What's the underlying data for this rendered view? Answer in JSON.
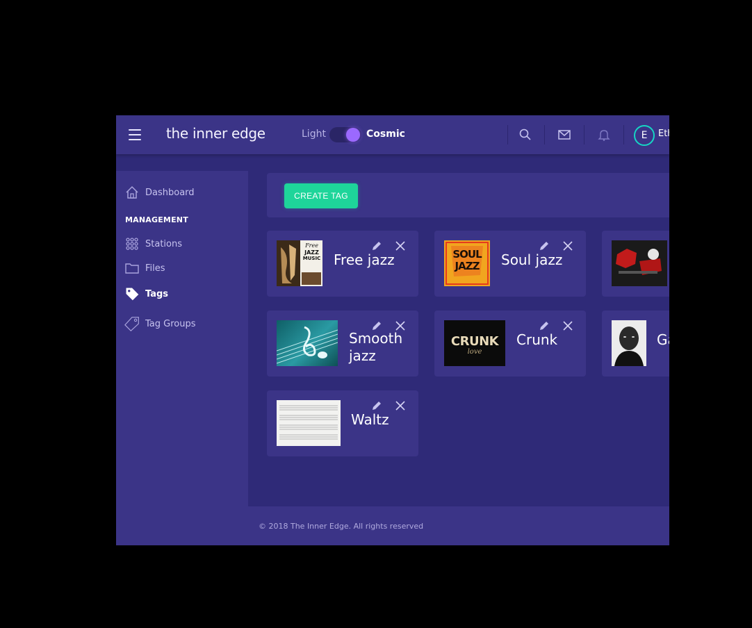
{
  "header": {
    "brand": "the inner edge",
    "theme_light": "Light",
    "theme_cosmic": "Cosmic",
    "avatar_initial": "E",
    "user_name": "Eth"
  },
  "sidebar": {
    "dashboard": "Dashboard",
    "group": "MANAGEMENT",
    "stations": "Stations",
    "files": "Files",
    "tags": "Tags",
    "tag_groups": "Tag Groups"
  },
  "toolbar": {
    "create_tag": "CREATE TAG"
  },
  "tags": [
    {
      "name": "Free jazz"
    },
    {
      "name": "Soul jazz"
    },
    {
      "name": ""
    },
    {
      "name": "Smooth jazz"
    },
    {
      "name": "Crunk"
    },
    {
      "name": "Ga"
    },
    {
      "name": "Waltz"
    }
  ],
  "thumbs": {
    "free_jazz_line1": "Free",
    "free_jazz_line2": "JAZZ",
    "free_jazz_line3": "MUSIC",
    "soul_jazz": "SOUL JAZZ",
    "crunk_main": "CRUNK",
    "crunk_sub": "love"
  },
  "footer": {
    "copyright": "© 2018 The Inner Edge. All rights reserved"
  },
  "colors": {
    "accent": "#1ed59a",
    "avatar_ring": "#16d6c4",
    "toggle": "#9b69ff",
    "panel": "#3b3487",
    "background": "#2f2a78"
  }
}
